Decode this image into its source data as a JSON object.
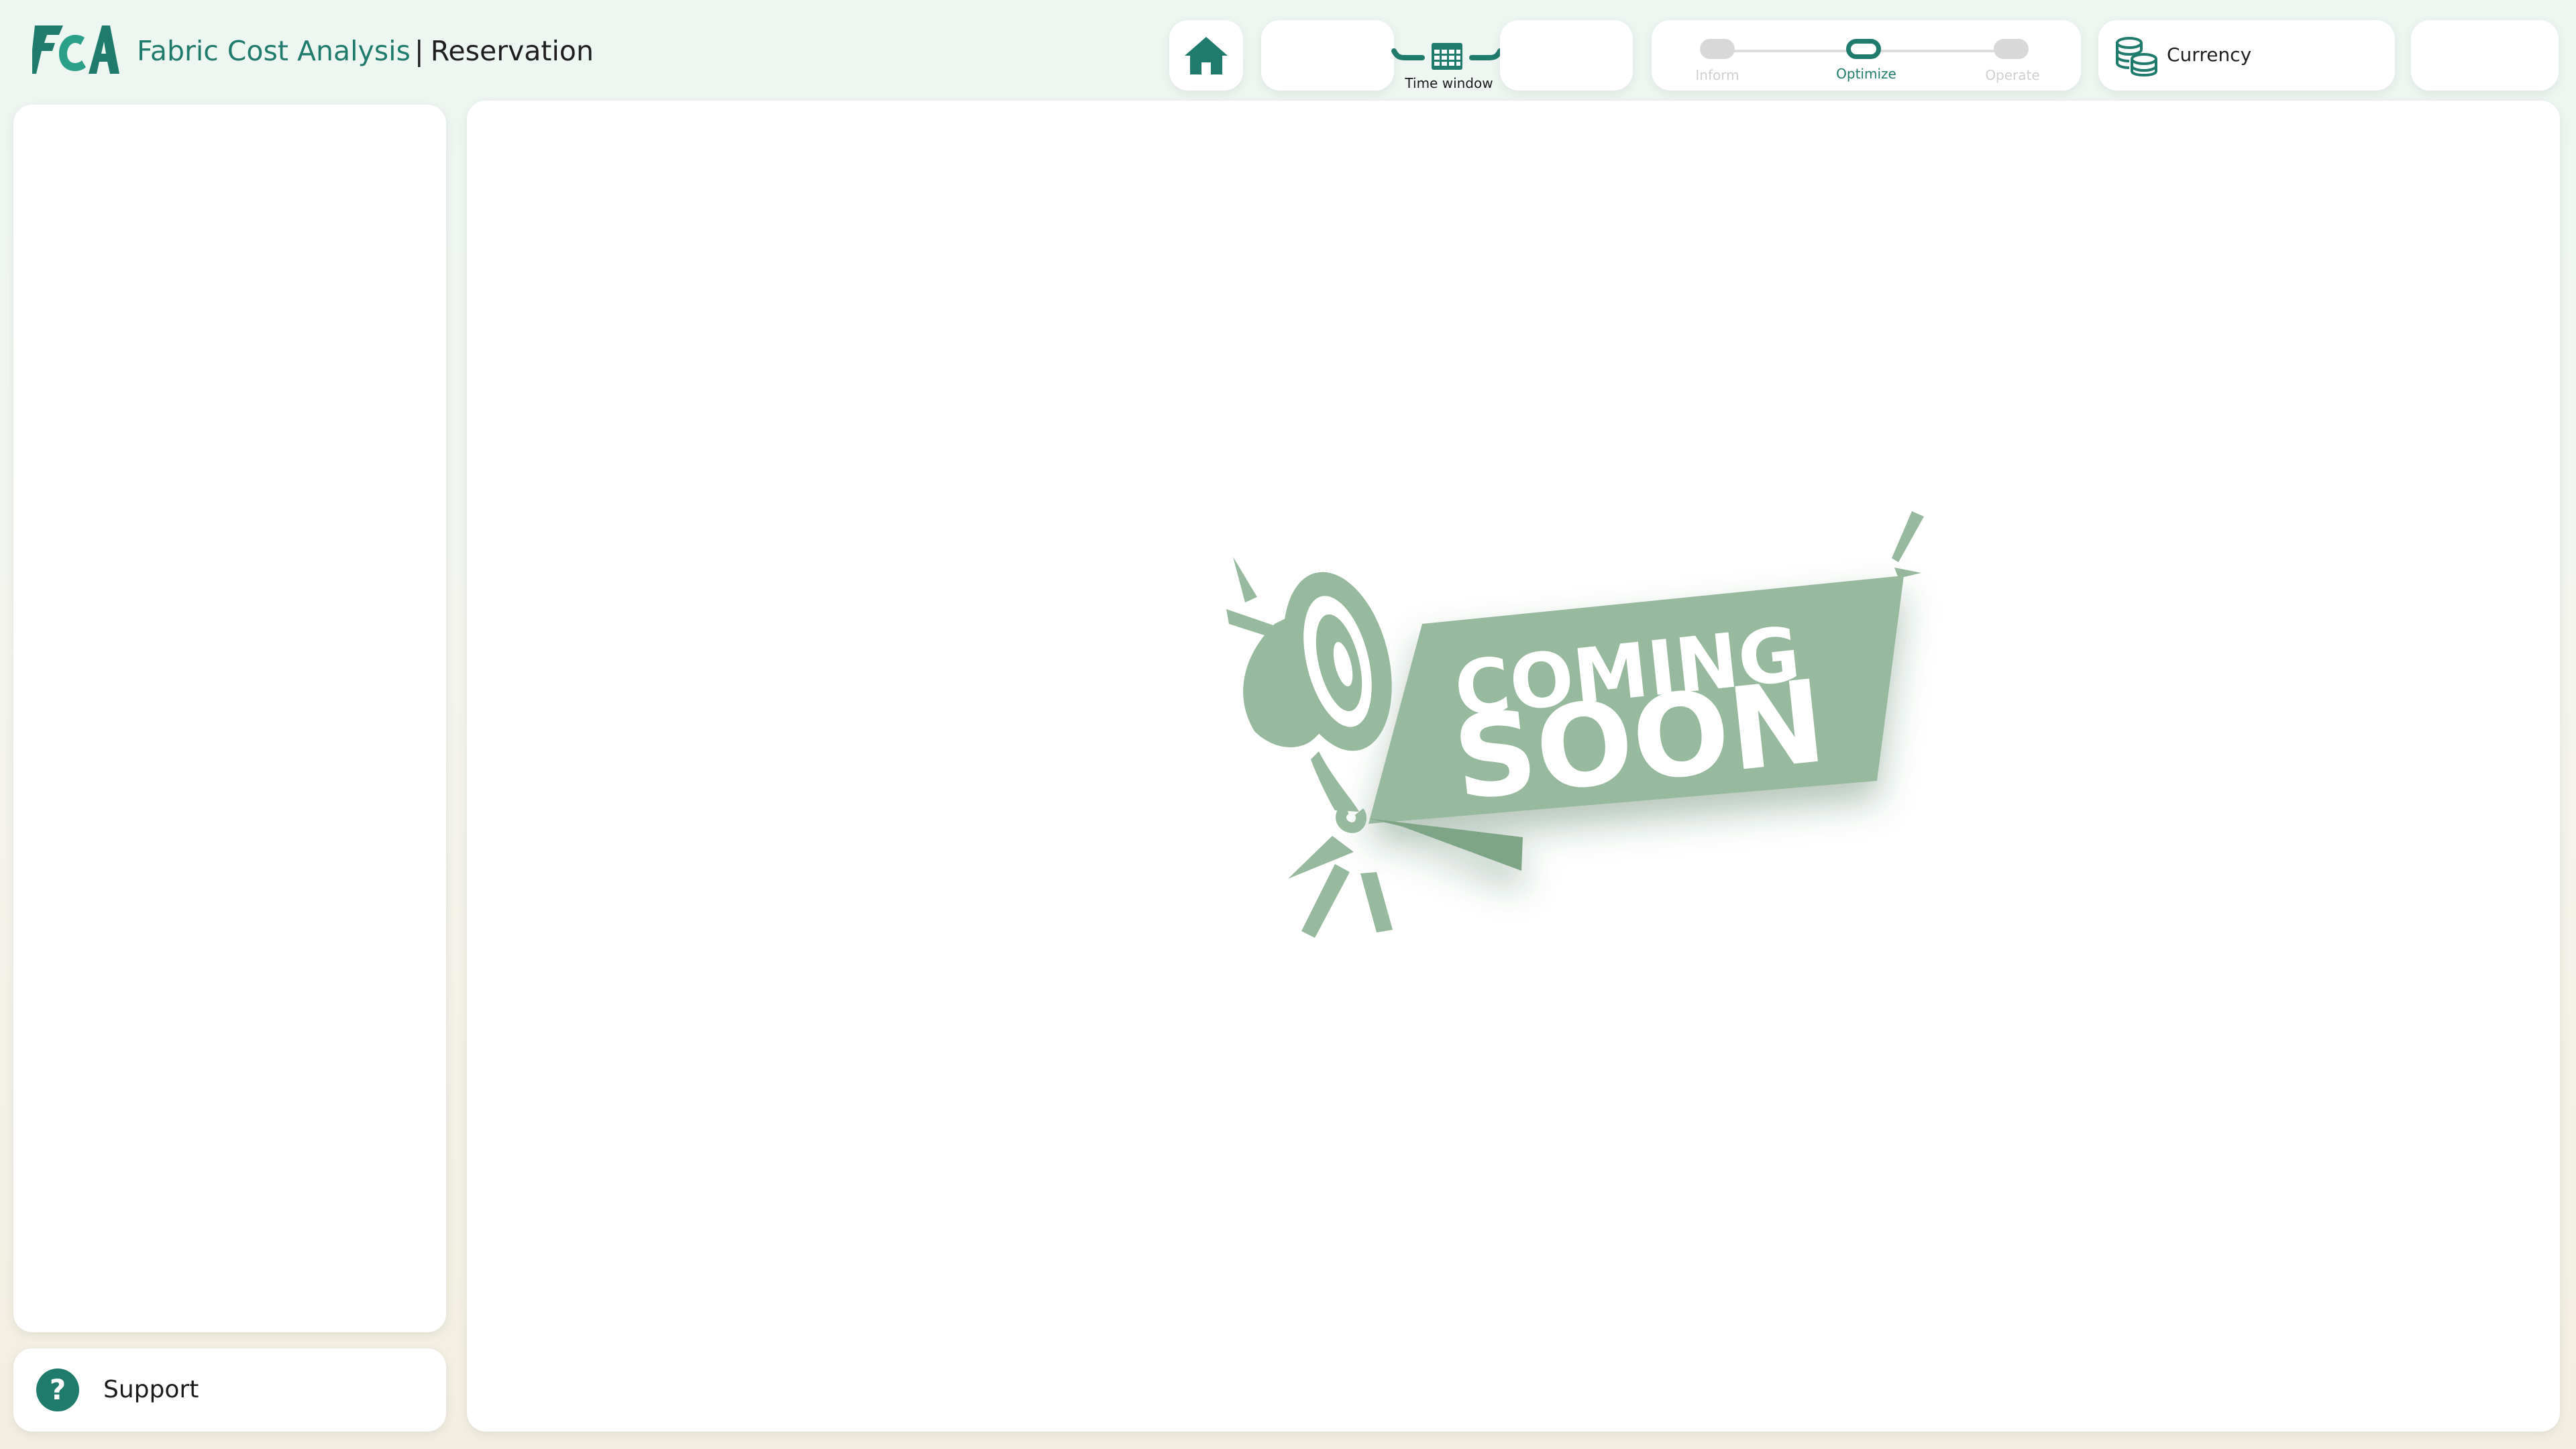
{
  "header": {
    "title": "Fabric Cost Analysis",
    "separator": "|",
    "page": "Reservation"
  },
  "time_window": {
    "label": "Time window"
  },
  "stepper": {
    "steps": [
      {
        "label": "Inform",
        "active": false
      },
      {
        "label": "Optimize",
        "active": true
      },
      {
        "label": "Operate",
        "active": false
      }
    ]
  },
  "currency": {
    "label": "Currency"
  },
  "sidebar": {
    "support_label": "Support",
    "support_icon": "?"
  },
  "main": {
    "banner": {
      "line1": "COMING",
      "line2": "SOON"
    }
  },
  "colors": {
    "accent": "#1f7b6b",
    "banner": "#97b99d",
    "inactive_step": "#d8d8d8"
  },
  "icons": [
    "fca-logo",
    "home-icon",
    "calendar-icon",
    "coins-icon",
    "help-icon",
    "megaphone-icon"
  ]
}
